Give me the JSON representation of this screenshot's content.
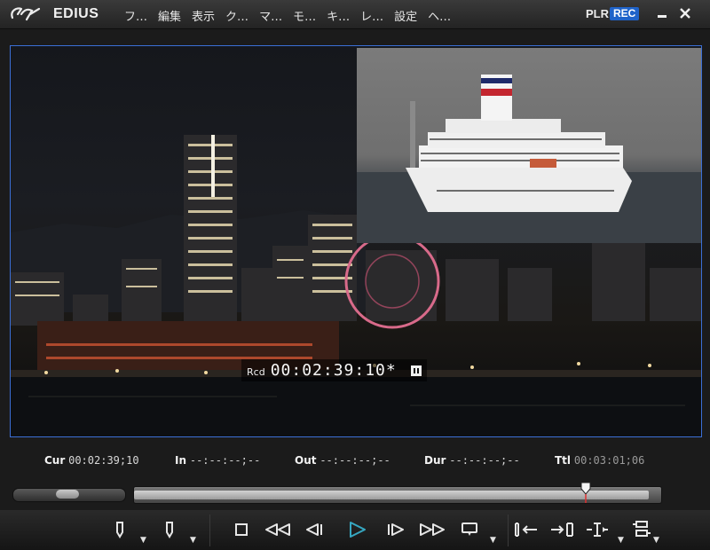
{
  "title_bar": {
    "app_name": "EDIUS",
    "menu": [
      "フ…",
      "編集",
      "表示",
      "ク…",
      "マ…",
      "モ…",
      "キ…",
      "レ…",
      "設定",
      "ヘ…"
    ],
    "mode_plr": "PLR",
    "mode_rec": "REC",
    "minimize_icon": "minimize-icon",
    "close_icon": "close-icon"
  },
  "monitor": {
    "rcd_label": "Rcd",
    "timecode": "00:02:39:10*",
    "state_icon": "pause-icon"
  },
  "info": {
    "cur_label": "Cur",
    "cur_value": "00:02:39;10",
    "in_label": "In",
    "in_value": "--:--:--;--",
    "out_label": "Out",
    "out_value": "--:--:--;--",
    "dur_label": "Dur",
    "dur_value": "--:--:--;--",
    "ttl_label": "Ttl",
    "ttl_value": "00:03:01;06"
  },
  "scrubber": {
    "position_fraction": 0.877
  },
  "transport": {
    "buttons": [
      "set-in-icon",
      "set-out-icon",
      "stop-icon",
      "rewind-icon",
      "step-back-icon",
      "play-icon",
      "step-forward-icon",
      "fast-forward-icon",
      "loop-icon",
      "insert-to-timeline-icon",
      "overwrite-to-timeline-icon",
      "three-point-edit-icon",
      "more-options-icon"
    ]
  },
  "colors": {
    "accent_rec": "#1f63c9",
    "monitor_border": "#3b6fd6",
    "play_icon": "#36a8c2"
  }
}
